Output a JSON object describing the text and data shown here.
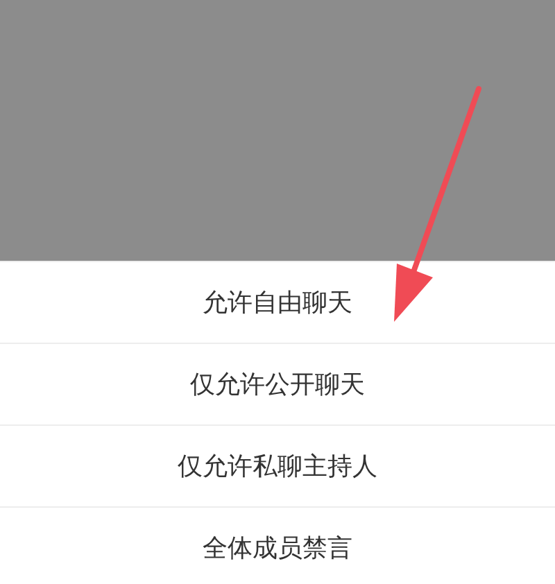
{
  "options": [
    {
      "label": "允许自由聊天"
    },
    {
      "label": "仅允许公开聊天"
    },
    {
      "label": "仅允许私聊主持人"
    },
    {
      "label": "全体成员禁言"
    }
  ],
  "annotation": {
    "kind": "arrow"
  }
}
